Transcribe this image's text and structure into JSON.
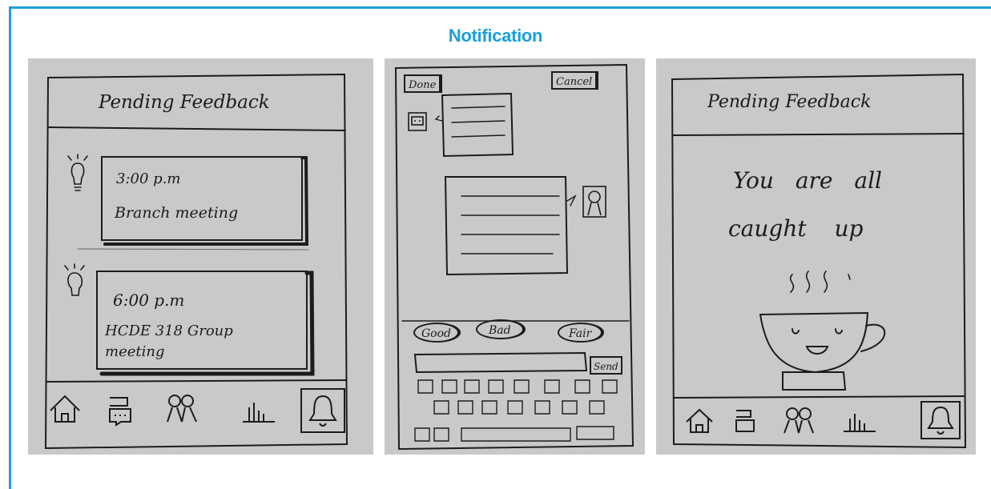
{
  "header": {
    "title": "Notification"
  },
  "screens": [
    {
      "header_title": "Pending Feedback",
      "cards": [
        {
          "time": "3:00 p.m",
          "event": "Branch meeting"
        },
        {
          "time": "6:00 p.m",
          "event_line1": "HCDE 318 Group",
          "event_line2": "meeting"
        }
      ],
      "nav_icons": [
        "home-icon",
        "chat-icon",
        "people-icon",
        "chart-icon",
        "bell-icon"
      ]
    },
    {
      "done_label": "Done",
      "cancel_label": "Cancel",
      "ratings": [
        "Good",
        "Bad",
        "Fair"
      ],
      "send_label": "Send"
    },
    {
      "header_title": "Pending Feedback",
      "message_line1": "You are all",
      "message_line2": "caught up",
      "nav_icons": [
        "home-icon",
        "chat-icon",
        "people-icon",
        "chart-icon",
        "bell-icon"
      ]
    }
  ],
  "colors": {
    "accent": "#1aa0dc",
    "paper": "#c9c9c9",
    "ink": "#1c1c1c"
  }
}
